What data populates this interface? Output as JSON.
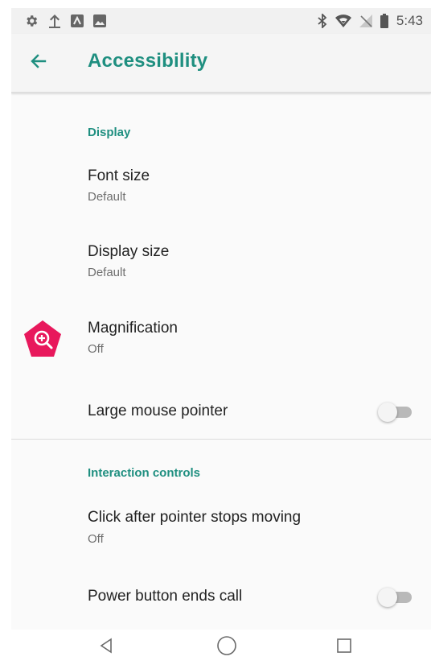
{
  "status_bar": {
    "time": "5:43",
    "left_icons": [
      "settings-icon",
      "upload-icon",
      "notification-app-icon",
      "image-icon"
    ],
    "right_icons": [
      "bluetooth-icon",
      "wifi-icon",
      "no-signal-icon",
      "battery-icon"
    ]
  },
  "app_bar": {
    "title": "Accessibility",
    "back_icon": "back-arrow-icon"
  },
  "sections": {
    "display": {
      "header": "Display",
      "font_size": {
        "title": "Font size",
        "summary": "Default"
      },
      "display_size": {
        "title": "Display size",
        "summary": "Default"
      },
      "magnification": {
        "title": "Magnification",
        "summary": "Off",
        "icon": "magnification-icon"
      },
      "large_mouse_pointer": {
        "title": "Large mouse pointer",
        "enabled": false
      }
    },
    "interaction": {
      "header": "Interaction controls",
      "click_after_pointer": {
        "title": "Click after pointer stops moving",
        "summary": "Off"
      },
      "power_button": {
        "title": "Power button ends call",
        "enabled": false
      }
    }
  },
  "nav_bar": {
    "buttons": [
      "back-nav-icon",
      "home-nav-icon",
      "recents-nav-icon"
    ]
  },
  "colors": {
    "accent": "#1f8f80",
    "magnification_icon": "#e8185c",
    "toggle_off_track": "#b9b9b9"
  }
}
